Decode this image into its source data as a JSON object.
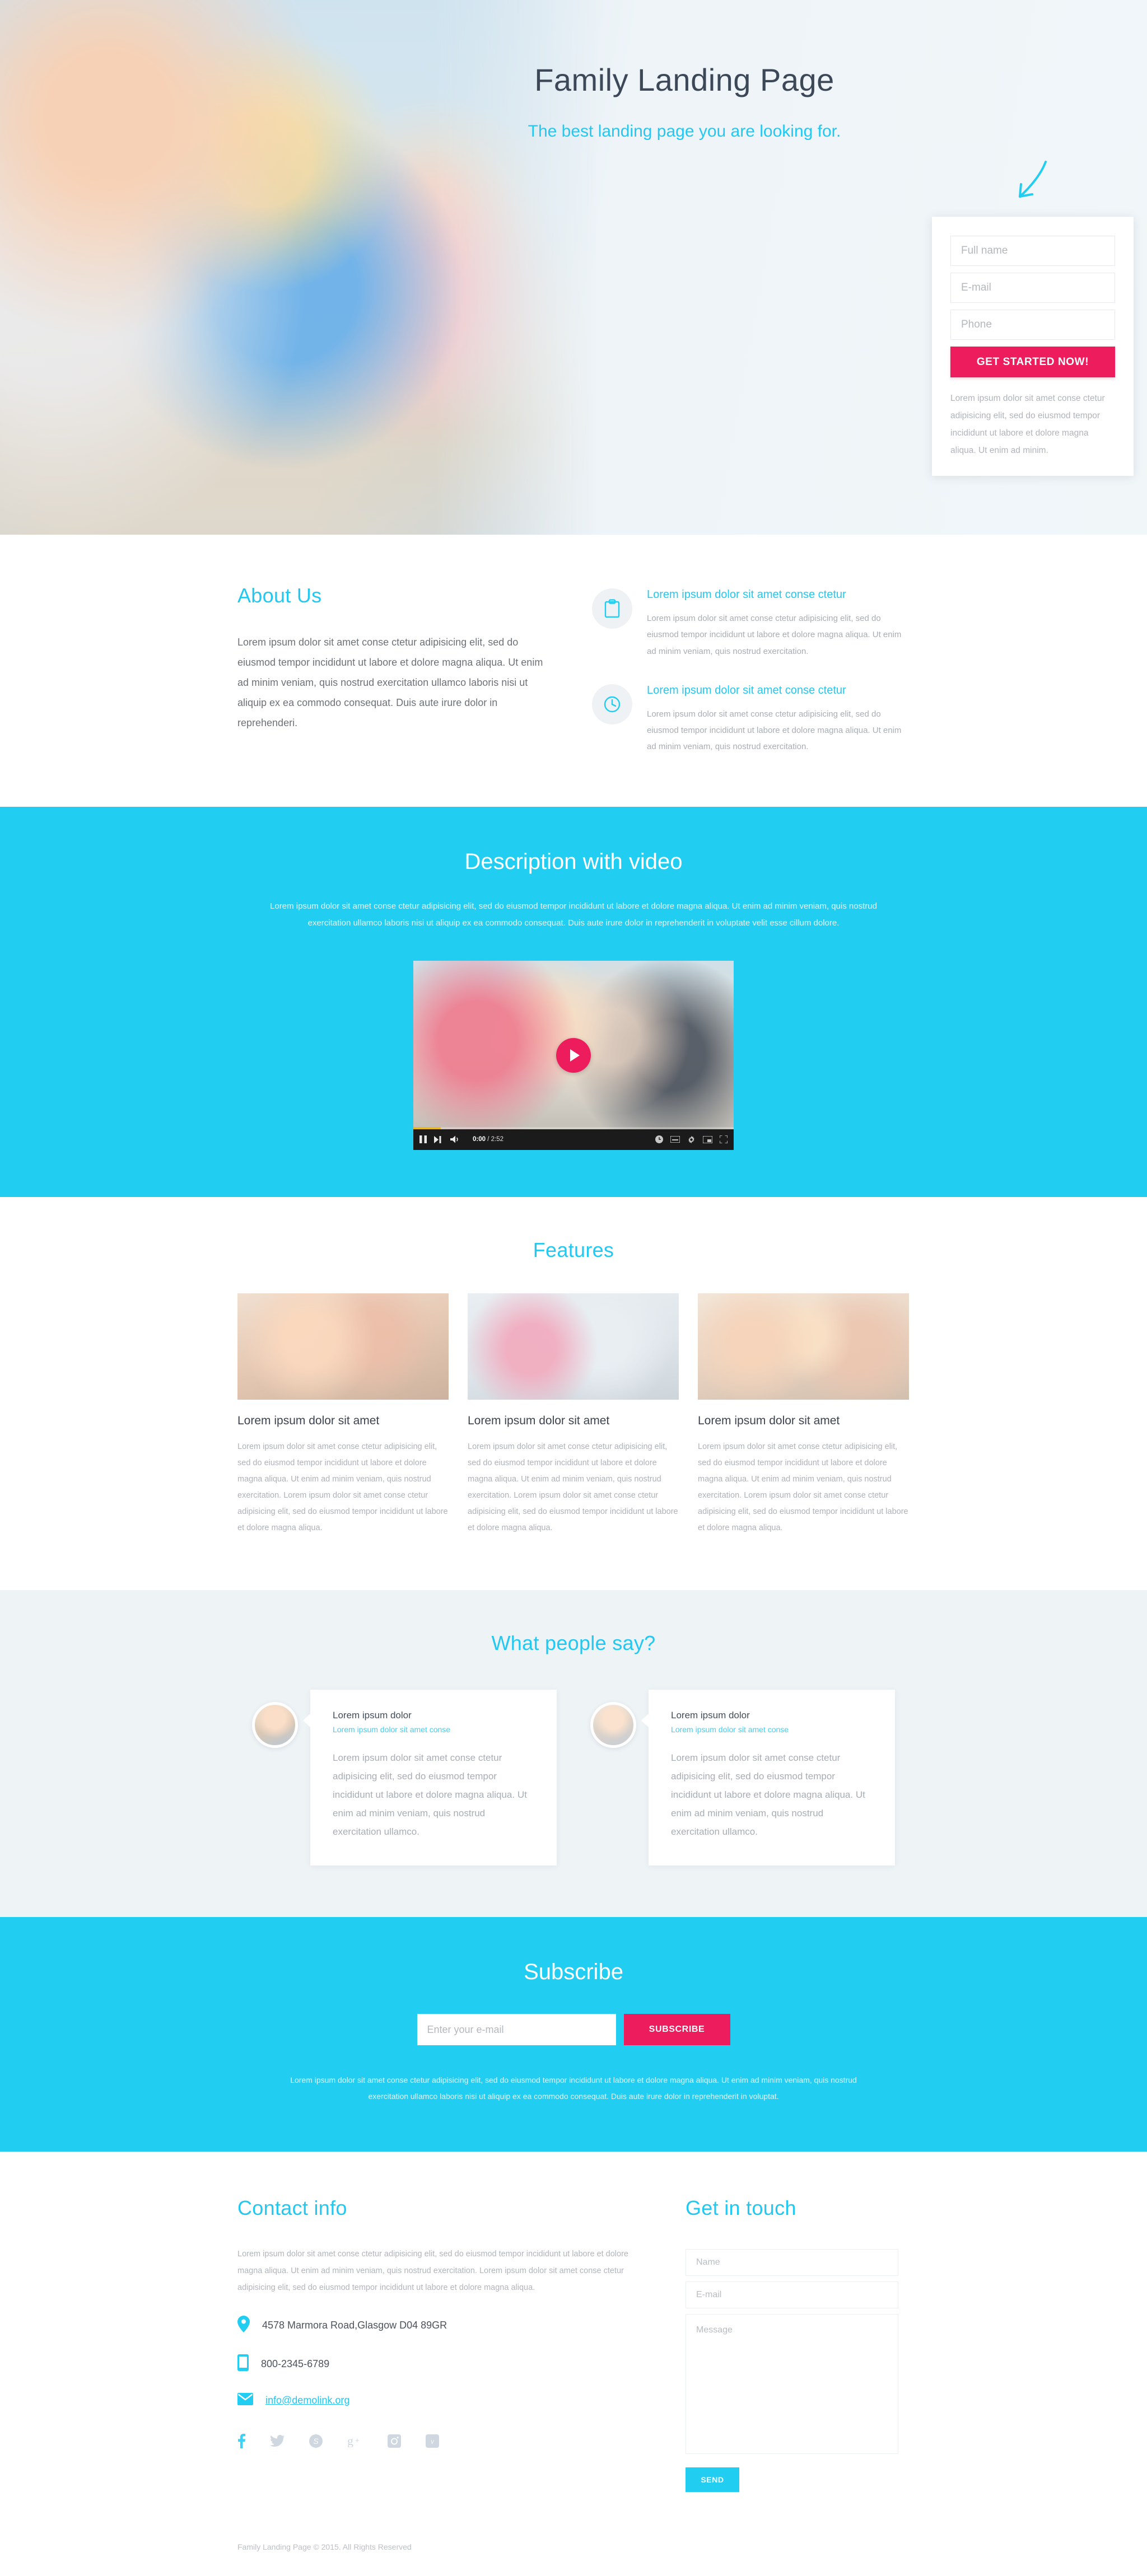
{
  "colors": {
    "accent_cyan": "#22cdf2",
    "accent_pink": "#ec1c5d",
    "heading_dark": "#3c4858",
    "body_gray": "#a9aeb4"
  },
  "hero": {
    "title": "Family Landing Page",
    "subtitle": "The best landing page you are looking for.",
    "form": {
      "fullname_placeholder": "Full name",
      "email_placeholder": "E-mail",
      "phone_placeholder": "Phone",
      "cta_label": "GET STARTED NOW!",
      "note": "Lorem ipsum dolor sit amet conse ctetur adipisicing elit, sed do eiusmod tempor incididunt ut labore et dolore magna aliqua. Ut enim ad minim."
    }
  },
  "about": {
    "heading": "About Us",
    "body": "Lorem ipsum dolor sit amet conse ctetur adipisicing elit, sed do eiusmod tempor incididunt ut labore et dolore magna aliqua. Ut enim ad minim veniam, quis nostrud exercitation ullamco laboris nisi ut aliquip ex ea commodo consequat. Duis aute irure dolor in reprehenderi.",
    "items": [
      {
        "icon": "clipboard-icon",
        "title": "Lorem ipsum dolor sit amet conse ctetur",
        "text": "Lorem ipsum dolor sit amet conse ctetur adipisicing elit, sed do eiusmod tempor incididunt ut labore et dolore magna aliqua. Ut enim ad minim veniam, quis nostrud exercitation."
      },
      {
        "icon": "clock-icon",
        "title": "Lorem ipsum dolor sit amet conse ctetur",
        "text": "Lorem ipsum dolor sit amet conse ctetur adipisicing elit, sed do eiusmod tempor incididunt ut labore et dolore magna aliqua. Ut enim ad minim veniam, quis nostrud exercitation."
      }
    ]
  },
  "video": {
    "heading": "Description with video",
    "lead": "Lorem ipsum dolor sit amet conse ctetur adipisicing elit, sed do eiusmod tempor incididunt ut labore et dolore magna aliqua. Ut enim ad minim veniam, quis nostrud exercitation ullamco laboris nisi ut aliquip ex ea commodo consequat. Duis aute irure dolor in reprehenderit in voluptate velit esse cillum dolore.",
    "player": {
      "current_time": "0:00",
      "time_separator": " / ",
      "duration": "2:52",
      "progress_percent": 8.5
    }
  },
  "features": {
    "heading": "Features",
    "cards": [
      {
        "title": "Lorem ipsum dolor sit amet",
        "text": "Lorem ipsum dolor sit amet conse ctetur adipisicing elit, sed do eiusmod tempor incididunt ut labore et dolore magna aliqua. Ut enim ad minim veniam, quis nostrud exercitation. Lorem ipsum dolor sit amet conse ctetur adipisicing elit, sed do eiusmod tempor incididunt ut labore et dolore magna aliqua."
      },
      {
        "title": "Lorem ipsum dolor sit amet",
        "text": "Lorem ipsum dolor sit amet conse ctetur adipisicing elit, sed do eiusmod tempor incididunt ut labore et dolore magna aliqua. Ut enim ad minim veniam, quis nostrud exercitation. Lorem ipsum dolor sit amet conse ctetur adipisicing elit, sed do eiusmod tempor incididunt ut labore et dolore magna aliqua."
      },
      {
        "title": "Lorem ipsum dolor sit amet",
        "text": "Lorem ipsum dolor sit amet conse ctetur adipisicing elit, sed do eiusmod tempor incididunt ut labore et dolore magna aliqua. Ut enim ad minim veniam, quis nostrud exercitation. Lorem ipsum dolor sit amet conse ctetur adipisicing elit, sed do eiusmod tempor incididunt ut labore et dolore magna aliqua."
      }
    ]
  },
  "testimonials": {
    "heading": "What people say?",
    "items": [
      {
        "name": "Lorem ipsum dolor",
        "role": "Lorem ipsum dolor sit amet conse",
        "quote": "Lorem ipsum dolor sit amet conse ctetur adipisicing elit, sed do eiusmod tempor incididunt ut labore et dolore magna aliqua. Ut enim ad minim veniam, quis nostrud exercitation ullamco."
      },
      {
        "name": "Lorem ipsum dolor",
        "role": "Lorem ipsum dolor sit amet conse",
        "quote": "Lorem ipsum dolor sit amet conse ctetur adipisicing elit, sed do eiusmod tempor incididunt ut labore et dolore magna aliqua. Ut enim ad minim veniam, quis nostrud exercitation ullamco."
      }
    ]
  },
  "subscribe": {
    "heading": "Subscribe",
    "email_placeholder": "Enter your e-mail",
    "button_label": "SUBSCRIBE",
    "note": "Lorem ipsum dolor sit amet conse ctetur adipisicing elit, sed do eiusmod tempor incididunt ut labore et dolore magna aliqua. Ut enim ad minim veniam, quis nostrud exercitation ullamco laboris nisi ut aliquip ex ea commodo consequat. Duis aute irure dolor in reprehenderit in voluptat."
  },
  "contact": {
    "heading": "Contact info",
    "body": "Lorem ipsum dolor sit amet conse ctetur adipisicing elit, sed do eiusmod tempor incididunt ut labore et dolore magna aliqua. Ut enim ad minim veniam, quis nostrud exercitation. Lorem ipsum dolor sit amet conse ctetur adipisicing elit, sed do eiusmod tempor incididunt ut labore et dolore magna aliqua.",
    "address": "4578 Marmora Road,Glasgow D04 89GR",
    "phone": "800-2345-6789",
    "email": "info@demolink.org",
    "socials": [
      "facebook-icon",
      "twitter-icon",
      "skype-icon",
      "google-plus-icon",
      "instagram-icon",
      "vimeo-icon"
    ]
  },
  "get_in_touch": {
    "heading": "Get in touch",
    "name_placeholder": "Name",
    "email_placeholder": "E-mail",
    "message_placeholder": "Message",
    "send_label": "SEND"
  },
  "footer": {
    "copyright": "Family Landing Page © 2015.  All Rights Reserved"
  }
}
